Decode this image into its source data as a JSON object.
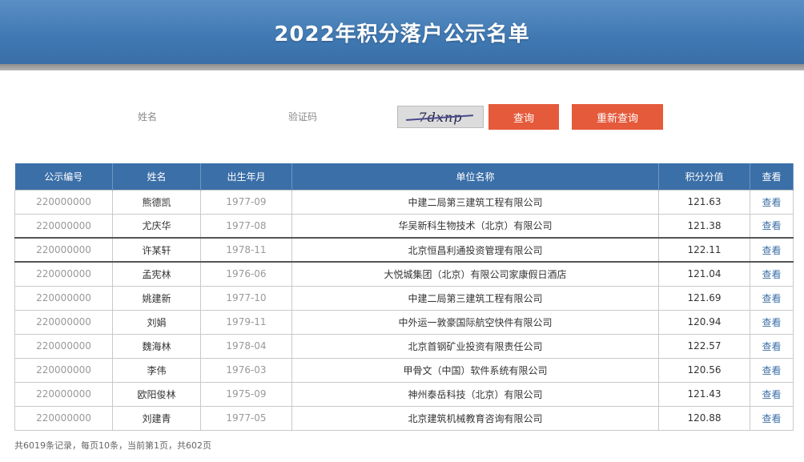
{
  "header": {
    "title": "2022年积分落户公示名单"
  },
  "search": {
    "name_label": "姓名",
    "code_label": "验证码",
    "captcha_text": "7dxnp",
    "query_button": "查询",
    "reset_button": "重新查询"
  },
  "table": {
    "columns": [
      "公示编号",
      "姓名",
      "出生年月",
      "单位名称",
      "积分分值",
      "查看"
    ],
    "rows": [
      {
        "id": "220000000",
        "name": "熊德凯",
        "birth": "1977-09",
        "company": "中建二局第三建筑工程有限公司",
        "score": "121.63",
        "view": "查看"
      },
      {
        "id": "220000000",
        "name": "尤庆华",
        "birth": "1977-08",
        "company": "华吴新科生物技术（北京）有限公司",
        "score": "121.38",
        "view": "查看"
      },
      {
        "id": "220000000",
        "name": "许某轩",
        "birth": "1978-11",
        "company": "北京恒昌利通投资管理有限公司",
        "score": "122.11",
        "view": "查看"
      },
      {
        "id": "220000000",
        "name": "孟宪林",
        "birth": "1976-06",
        "company": "大悦城集团（北京）有限公司家康假日酒店",
        "score": "121.04",
        "view": "查看"
      },
      {
        "id": "220000000",
        "name": "姚建新",
        "birth": "1977-10",
        "company": "中建二局第三建筑工程有限公司",
        "score": "121.69",
        "view": "查看"
      },
      {
        "id": "220000000",
        "name": "刘娟",
        "birth": "1979-11",
        "company": "中外运一敦豪国际航空快件有限公司",
        "score": "120.94",
        "view": "查看"
      },
      {
        "id": "220000000",
        "name": "魏海林",
        "birth": "1978-04",
        "company": "北京首钢矿业投资有限责任公司",
        "score": "122.57",
        "view": "查看"
      },
      {
        "id": "220000000",
        "name": "李伟",
        "birth": "1976-03",
        "company": "甲骨文（中国）软件系统有限公司",
        "score": "120.56",
        "view": "查看"
      },
      {
        "id": "220000000",
        "name": "欧阳俊林",
        "birth": "1975-09",
        "company": "神州泰岳科技（北京）有限公司",
        "score": "121.43",
        "view": "查看"
      },
      {
        "id": "220000000",
        "name": "刘建青",
        "birth": "1977-05",
        "company": "北京建筑机械教育咨询有限公司",
        "score": "120.88",
        "view": "查看"
      }
    ]
  },
  "footer": {
    "text": "共6019条记录，每页10条，当前第1页，共602页"
  }
}
